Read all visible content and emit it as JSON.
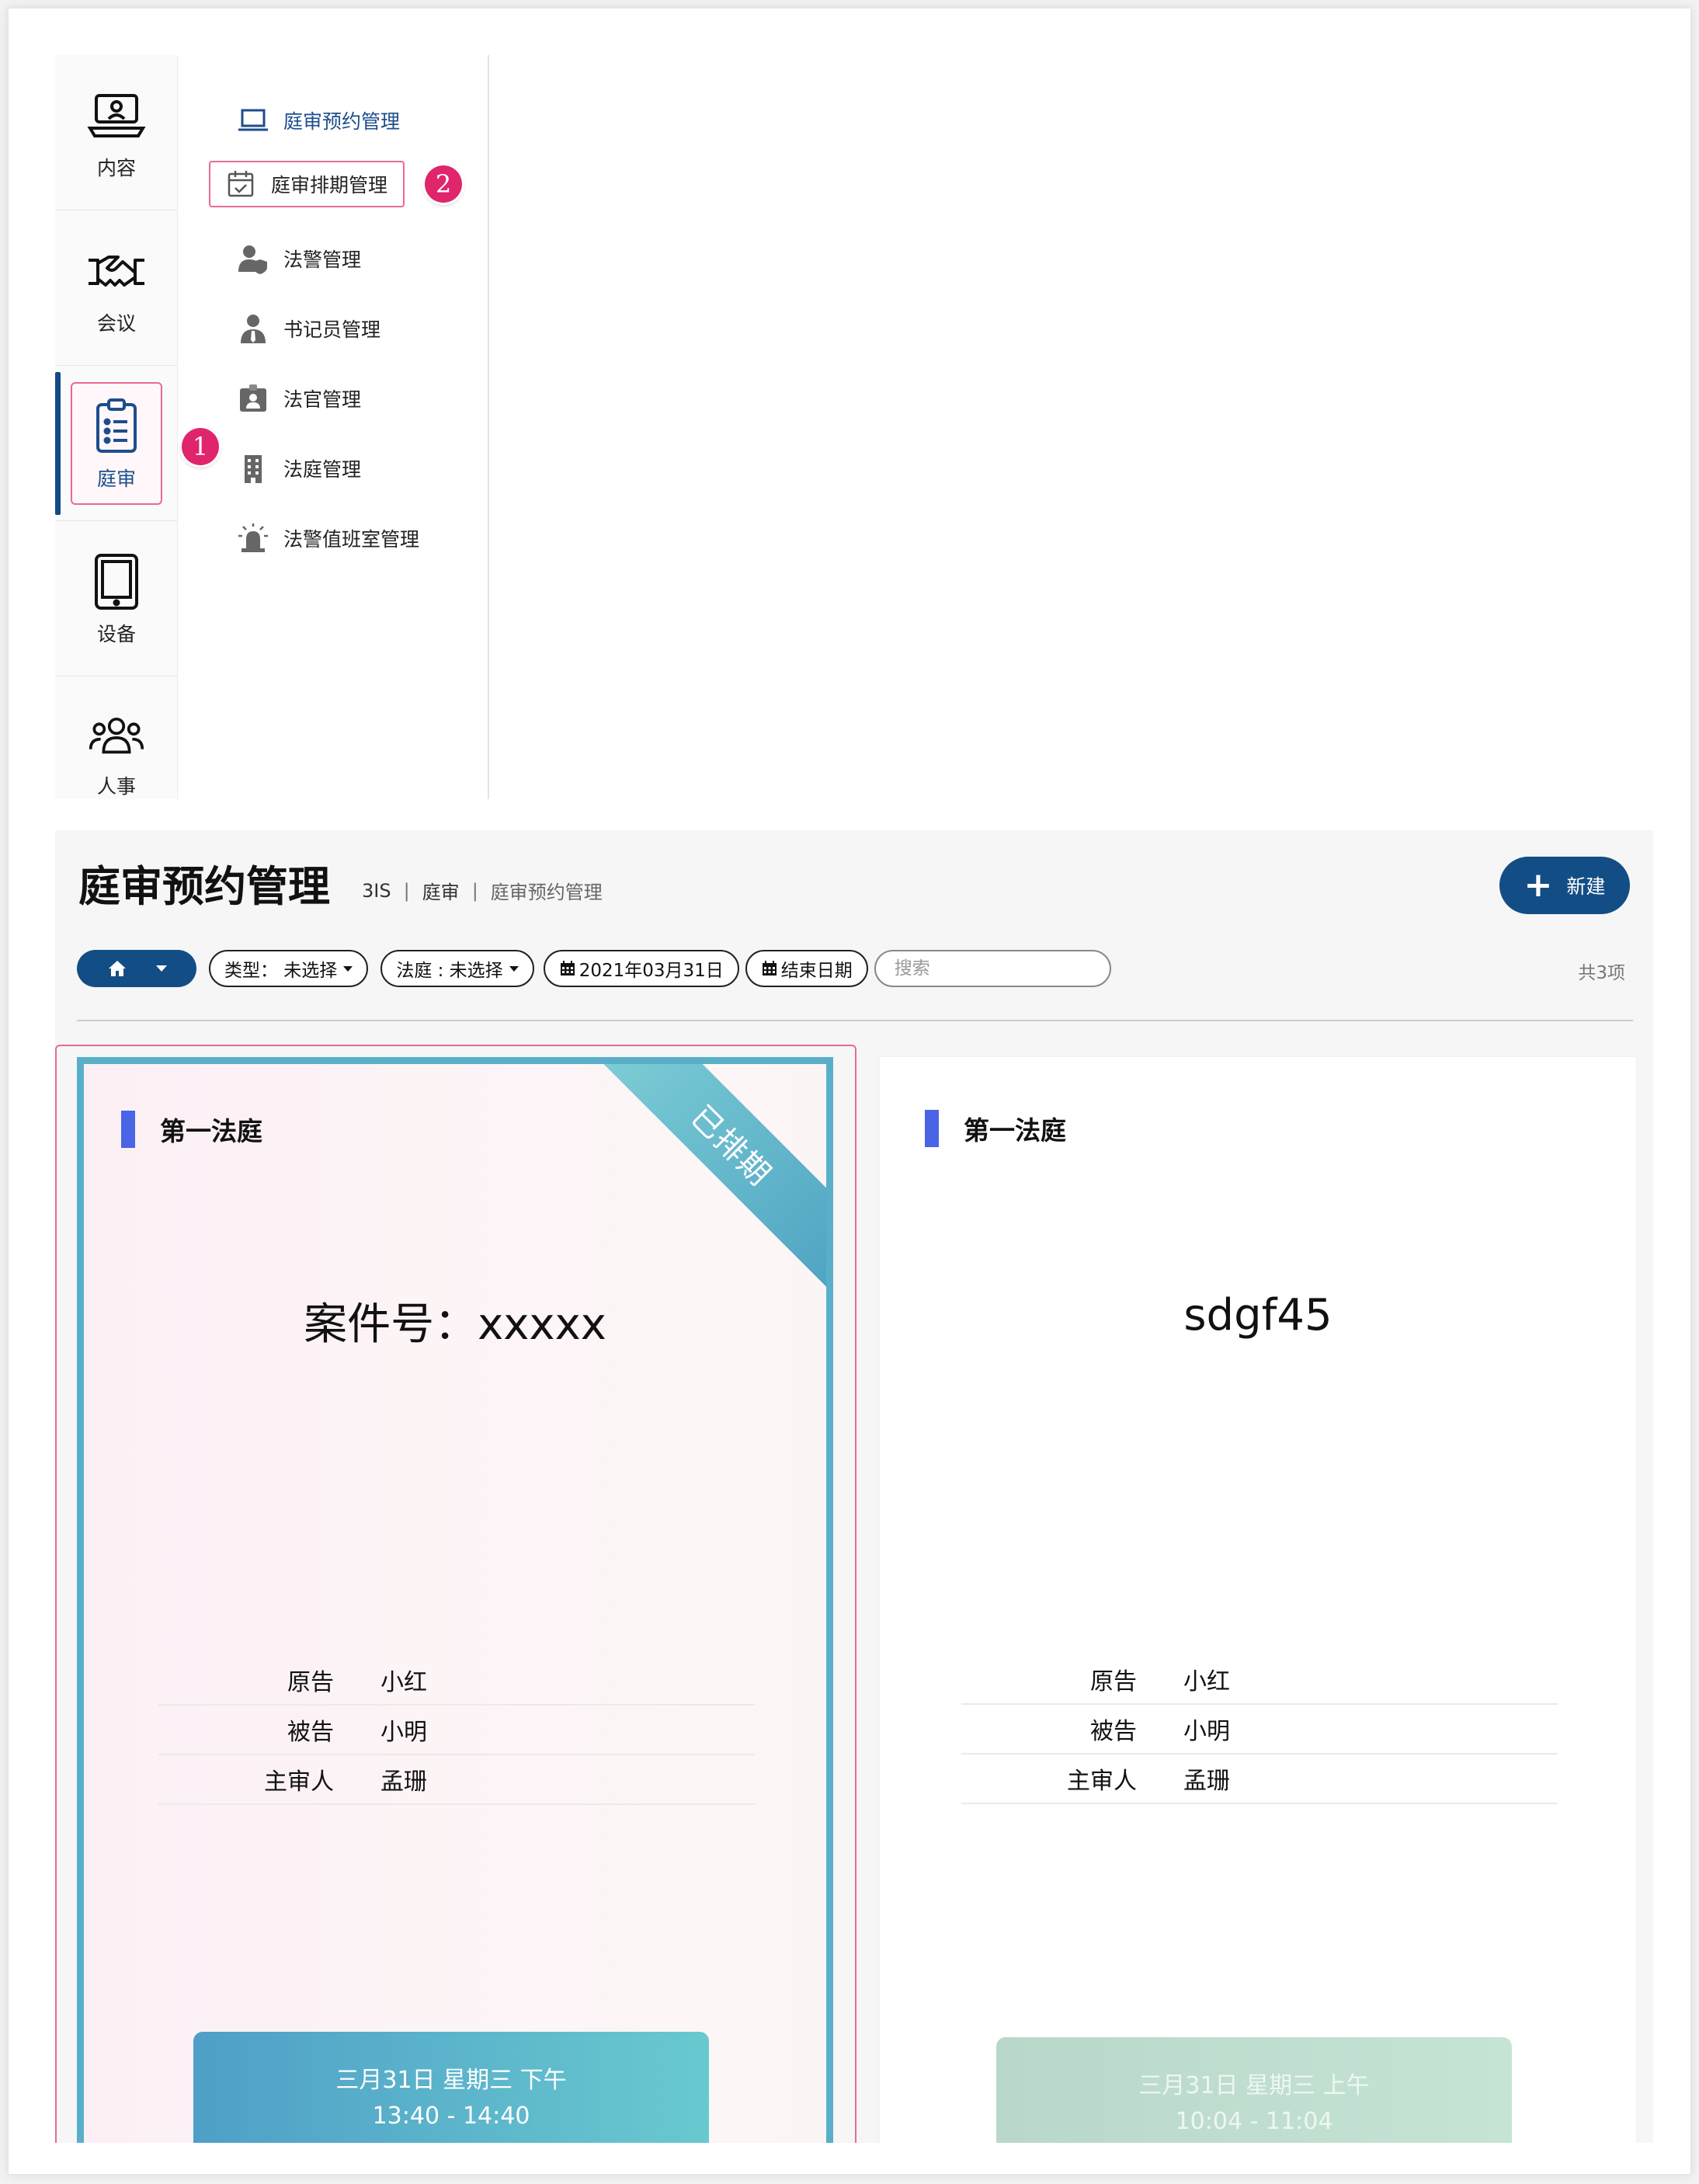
{
  "sidebar": {
    "rail": [
      {
        "label": "内容",
        "icon": "laptop-user-icon"
      },
      {
        "label": "会议",
        "icon": "handshake-icon"
      },
      {
        "label": "庭审",
        "icon": "clipboard-list-icon",
        "active": true
      },
      {
        "label": "设备",
        "icon": "tablet-icon"
      },
      {
        "label": "人事",
        "icon": "users-icon"
      }
    ],
    "submenu": [
      {
        "label": "庭审预约管理",
        "icon": "laptop-icon"
      },
      {
        "label": "庭审排期管理",
        "icon": "calendar-check-icon"
      },
      {
        "label": "法警管理",
        "icon": "user-shield-icon"
      },
      {
        "label": "书记员管理",
        "icon": "user-tie-icon"
      },
      {
        "label": "法官管理",
        "icon": "id-badge-icon"
      },
      {
        "label": "法庭管理",
        "icon": "building-icon"
      },
      {
        "label": "法警值班室管理",
        "icon": "siren-icon"
      }
    ],
    "step_badges": [
      "1",
      "2"
    ]
  },
  "header": {
    "title": "庭审预约管理",
    "breadcrumb": [
      "3IS",
      "庭审",
      "庭审预约管理"
    ],
    "breadcrumb_sep": "|",
    "new_button": "新建"
  },
  "filters": {
    "type": "类型： 未选择",
    "court": "法庭 : 未选择",
    "start_date": "2021年03月31日",
    "end_date": "结束日期",
    "search_placeholder": "搜索",
    "total": "共3项"
  },
  "cards": [
    {
      "court": "第一法庭",
      "case": "案件号：xxxxx",
      "status_ribbon": "已排期",
      "rows": [
        {
          "label": "原告",
          "value": "小红"
        },
        {
          "label": "被告",
          "value": "小明"
        },
        {
          "label": "主审人",
          "value": "孟珊"
        }
      ],
      "time_line1": "三月31日 星期三 下午",
      "time_line2": "13:40 - 14:40"
    },
    {
      "court": "第一法庭",
      "case": "sdgf45",
      "rows": [
        {
          "label": "原告",
          "value": "小红"
        },
        {
          "label": "被告",
          "value": "小明"
        },
        {
          "label": "主审人",
          "value": "孟珊"
        }
      ],
      "time_line1": "三月31日 星期三 上午",
      "time_line2": "10:04 - 11:04"
    }
  ],
  "colors": {
    "primary": "#134d85",
    "highlight": "#e66b92",
    "badge": "#e0256d",
    "court_bar": "#4a64e6",
    "scheduled_border": "#5aafc8"
  }
}
